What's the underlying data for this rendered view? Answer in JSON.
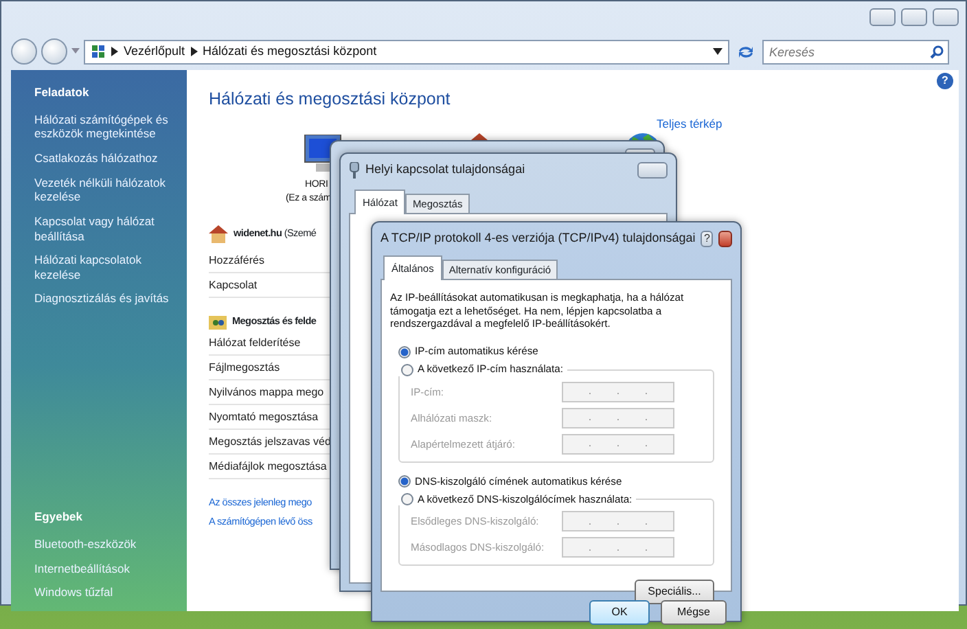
{
  "address_bar": {
    "breadcrumb": [
      "Vezérlőpult",
      "Hálózati és megosztási központ"
    ]
  },
  "search": {
    "placeholder": "Keresés"
  },
  "sidebar": {
    "sections": [
      {
        "title": "Feladatok",
        "items": [
          "Hálózati számítógépek és eszközök megtekintése",
          "Csatlakozás hálózathoz",
          "Vezeték nélküli hálózatok kezelése",
          "Kapcsolat vagy hálózat beállítása",
          "Hálózati kapcsolatok kezelése",
          "Diagnosztizálás és javítás"
        ]
      },
      {
        "title": "Egyebek",
        "items": [
          "Bluetooth-eszközök",
          "Internetbeállítások",
          "Windows tűzfal"
        ]
      }
    ]
  },
  "content": {
    "title": "Hálózati és megosztási központ",
    "help": "?",
    "map": {
      "link": "Teljes térkép",
      "computer_name": "HORI",
      "computer_note": "(Ez a szám"
    },
    "network": {
      "name": "**widenet.hu** (Szemé",
      "rows": [
        "Hozzáférés",
        "Kapcsolat"
      ]
    },
    "sharing": {
      "title": "Megosztás és felde",
      "rows": [
        "Hálózat felderítése",
        "Fájlmegosztás",
        "Nyilvános mappa mego",
        "Nyomtató megosztása",
        "Megosztás jelszavas véd",
        "Médiafájlok megosztása"
      ]
    },
    "links": [
      "Az összes jelenleg mego",
      "A számítógépen lévő öss"
    ]
  },
  "properties_dialog": {
    "title": "Helyi kapcsolat tulajdonságai",
    "tabs": [
      {
        "label": "Hálózat",
        "selected": true
      },
      {
        "label": "Megosztás",
        "selected": false
      }
    ]
  },
  "tcpip_dialog": {
    "title": "A TCP/IP protokoll 4-es verziója (TCP/IPv4) tulajdonságai",
    "help": "?",
    "tabs": [
      {
        "label": "Általános",
        "selected": true
      },
      {
        "label": "Alternatív konfiguráció",
        "selected": false
      }
    ],
    "intro": "Az IP-beállításokat automatikusan is megkaphatja, ha a hálózat támogatja ezt a lehetőséget. Ha nem, lépjen kapcsolatba a rendszergazdával a megfelelő IP-beállításokért.",
    "groups": [
      {
        "options": [
          {
            "label": "IP-cím automatikus kérése",
            "selected": true
          },
          {
            "label": "A következő IP-cím használata:",
            "selected": false
          }
        ],
        "disabled": true,
        "fields": [
          {
            "label": "IP-cím:"
          },
          {
            "label": "Alhálózati maszk:"
          },
          {
            "label": "Alapértelmezett átjáró:"
          }
        ]
      },
      {
        "options": [
          {
            "label": "DNS-kiszolgáló címének automatikus kérése",
            "selected": true
          },
          {
            "label": "A következő DNS-kiszolgálócímek használata:",
            "selected": false
          }
        ],
        "disabled": true,
        "fields": [
          {
            "label": "Elsődleges DNS-kiszolgáló:"
          },
          {
            "label": "Másodlagos DNS-kiszolgáló:"
          }
        ]
      }
    ],
    "separator": ".",
    "buttons": {
      "advanced": "Speciális...",
      "ok": "OK",
      "cancel": "Mégse"
    }
  }
}
